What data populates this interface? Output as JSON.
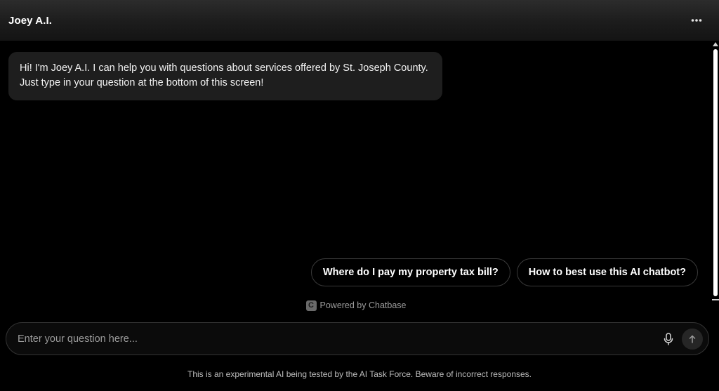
{
  "header": {
    "title": "Joey A.I.",
    "menu_icon": "more-horizontal-icon"
  },
  "chat": {
    "messages": [
      {
        "role": "assistant",
        "text": "Hi! I'm Joey A.I. I can help you with questions about services offered by St. Joseph County. Just type in your question at the bottom of this screen!"
      }
    ]
  },
  "suggestions": [
    {
      "label": "Where do I pay my property tax bill?"
    },
    {
      "label": "How to best use this AI chatbot?"
    }
  ],
  "branding": {
    "logo_letter": "C",
    "powered_text": "Powered by Chatbase"
  },
  "composer": {
    "placeholder": "Enter your question here...",
    "value": "",
    "mic_icon": "microphone-icon",
    "send_icon": "arrow-up-icon"
  },
  "footer": {
    "disclaimer": "This is an experimental AI being tested by the AI Task Force. Beware of incorrect responses."
  },
  "colors": {
    "background": "#000000",
    "header": "#1e1e1e",
    "bubble": "#1e1e1e",
    "chip_border": "#3a3a3a",
    "muted_text": "#9a9a9a"
  }
}
